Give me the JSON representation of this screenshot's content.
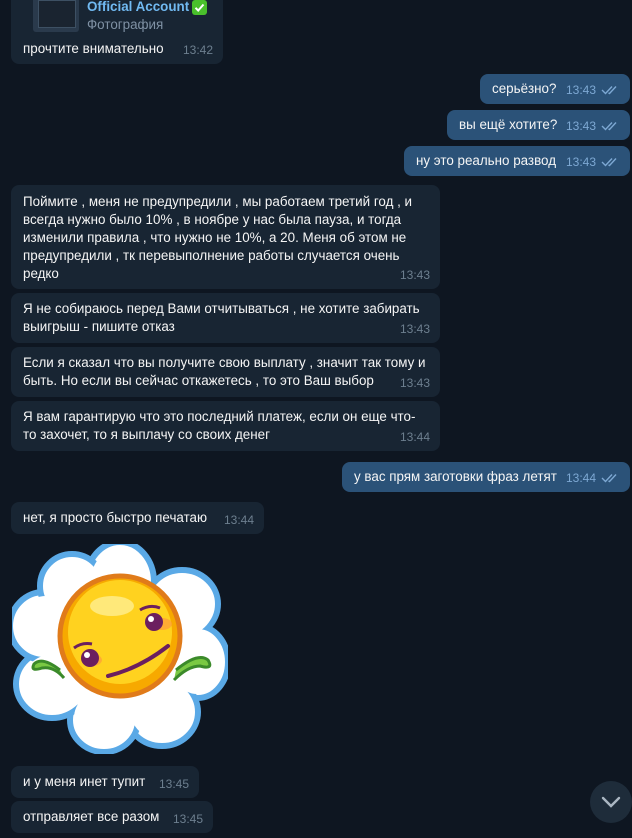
{
  "forward": {
    "sender": "Official Account",
    "verified_icon": "check-badge-icon",
    "media_type": "Фотография",
    "text": "прочтите внимательно",
    "time": "13:42"
  },
  "messages": [
    {
      "dir": "out",
      "text": "серьёзно?",
      "time": "13:43"
    },
    {
      "dir": "out",
      "text": "вы ещё хотите?",
      "time": "13:43"
    },
    {
      "dir": "out",
      "text": "ну это реально развод",
      "time": "13:43"
    },
    {
      "dir": "in",
      "text": "Поймите , меня не предупредили , мы работаем третий год , и всегда нужно было 10% , в ноябре у нас была пауза, и тогда изменили правила , что нужно не 10%, а 20. Меня об этом не предупредили , тк перевыполнение работы случается очень редко",
      "time": "13:43"
    },
    {
      "dir": "in",
      "text": "Я не собираюсь перед Вами отчитываться , не хотите забирать выигрыш - пишите отказ",
      "time": "13:43"
    },
    {
      "dir": "in",
      "text": "Если я сказал что вы получите свою выплату , значит так тому и быть. Но если вы сейчас откажетесь , то это Ваш выбор",
      "time": "13:43"
    },
    {
      "dir": "in",
      "text": "Я вам гарантирую что это последний платеж, если он еще что-то захочет, то я выплачу со своих денег",
      "time": "13:44"
    },
    {
      "dir": "out",
      "text": "у вас прям заготовки фраз летят",
      "time": "13:44"
    },
    {
      "dir": "in",
      "text": "нет, я просто быстро печатаю",
      "time": "13:44"
    },
    {
      "dir": "in",
      "text": "и у меня инет тупит",
      "time": "13:45"
    },
    {
      "dir": "in",
      "text": "отправляет все разом",
      "time": "13:45"
    }
  ],
  "sticker": {
    "name": "daisy-sticker"
  },
  "colors": {
    "background": "#0e1621",
    "incoming": "#182533",
    "outgoing": "#2b5278",
    "accent": "#71baf2"
  }
}
